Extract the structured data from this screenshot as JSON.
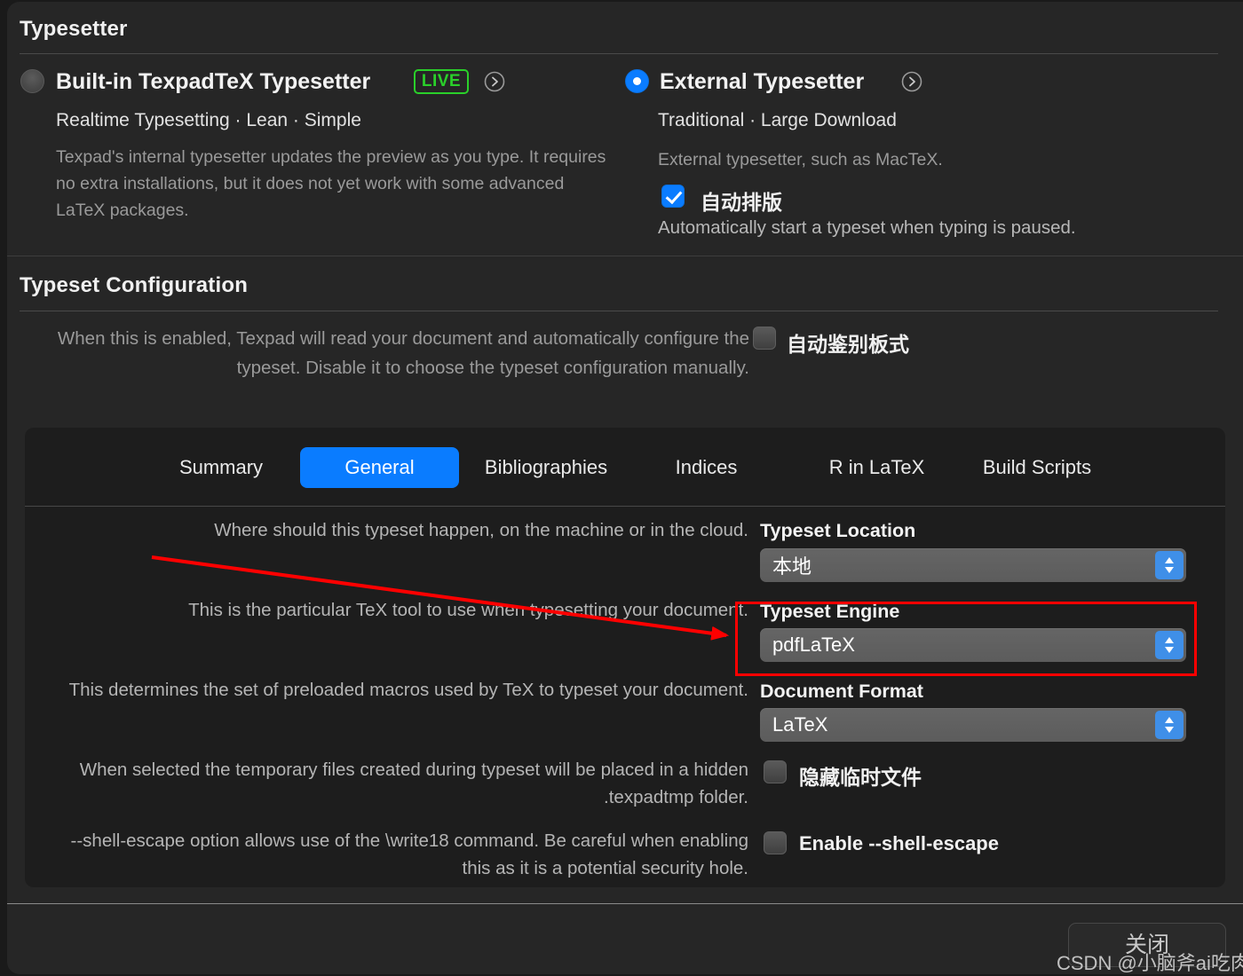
{
  "window": {
    "sections": {
      "typesetter": {
        "title": "Typesetter"
      },
      "config": {
        "title": "Typeset Configuration"
      }
    }
  },
  "typesetter": {
    "builtin": {
      "title": "Built-in TexpadTeX Typesetter",
      "badge": "LIVE",
      "subtitle": "Realtime Typesetting · Lean · Simple",
      "description": "Texpad's internal typesetter updates the preview as you type. It requires no extra installations, but it does not yet work with some advanced LaTeX packages.",
      "selected": false,
      "disclosure_icon": "chevron-right-circle-icon"
    },
    "external": {
      "title": "External Typesetter",
      "subtitle": "Traditional · Large Download",
      "description": "External typesetter, such as MacTeX.",
      "selected": true,
      "disclosure_icon": "chevron-right-circle-icon",
      "auto_typeset": {
        "label": "自动排版",
        "checked": true,
        "note": "Automatically start a typeset when typing is paused."
      }
    }
  },
  "config": {
    "description": "When this is enabled, Texpad will read your document and automatically configure the typeset. Disable it to choose the typeset configuration manually.",
    "auto_detect": {
      "label": "自动鉴别板式",
      "checked": false
    },
    "tabs": [
      {
        "label": "Summary",
        "active": false
      },
      {
        "label": "General",
        "active": true
      },
      {
        "label": "Bibliographies",
        "active": false
      },
      {
        "label": "Indices",
        "active": false
      },
      {
        "label": "R in LaTeX",
        "active": false
      },
      {
        "label": "Build Scripts",
        "active": false
      }
    ],
    "rows": {
      "location": {
        "description": "Where should this typeset happen, on the machine or in the cloud.",
        "label": "Typeset Location",
        "value": "本地"
      },
      "engine": {
        "description": "This is the particular TeX tool to use when typesetting your document.",
        "label": "Typeset Engine",
        "value": "pdfLaTeX",
        "highlighted": true
      },
      "format": {
        "description": "This determines the set of preloaded macros used by TeX to typeset your document.",
        "label": "Document Format",
        "value": "LaTeX"
      },
      "hide_temp": {
        "description": "When selected the temporary files created during typeset will be placed in a hidden .texpadtmp folder.",
        "label": "隐藏临时文件",
        "checked": false
      },
      "shell_escape": {
        "description": "--shell-escape option allows use of the \\write18 command. Be careful when enabling this as it is a potential security hole.",
        "label": "Enable --shell-escape",
        "checked": false
      }
    }
  },
  "footer": {
    "close_label": "关闭",
    "watermark": "CSDN @小脑斧ai吃肉"
  },
  "colors": {
    "accent": "#0a7cff",
    "live_green": "#2ad02a",
    "annotation_red": "#ff0000",
    "panel_bg": "#1d1d1d",
    "window_bg": "#262626"
  }
}
